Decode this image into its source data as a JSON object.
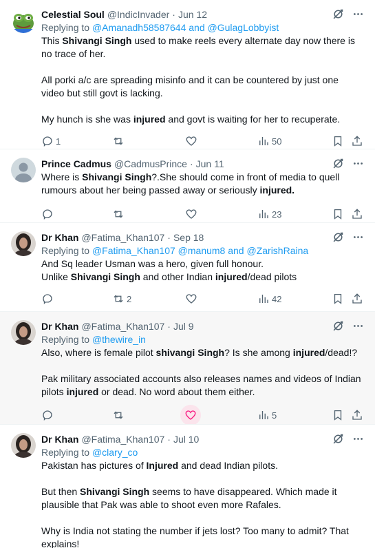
{
  "tweets": [
    {
      "name": "Celestial Soul",
      "handle": "@IndicInvader",
      "date": "Jun 12",
      "reply_prefix": "Replying to",
      "reply_targets": "@Amanadh58587644 and @GulagLobbyist",
      "paragraphs": [
        [
          {
            "t": "This "
          },
          {
            "t": "Shivangi Singh",
            "b": true
          },
          {
            "t": " used to make reels every alternate day now there is no trace of her."
          }
        ],
        [
          {
            "t": "All porki a/c are spreading misinfo and it can be countered by just one video but still govt is lacking."
          }
        ],
        [
          {
            "t": "My hunch is she was "
          },
          {
            "t": "injured",
            "b": true
          },
          {
            "t": " and govt is waiting for her to recuperate."
          }
        ]
      ],
      "replies": "1",
      "reposts": "",
      "likes": "",
      "views": "50"
    },
    {
      "name": "Prince Cadmus",
      "handle": "@CadmusPrince",
      "date": "Jun 11",
      "reply_prefix": "",
      "reply_targets": "",
      "paragraphs": [
        [
          {
            "t": "Where is "
          },
          {
            "t": "Shivangi Singh",
            "b": true
          },
          {
            "t": "?.She should come in front of media to quell rumours about her being passed away or seriously "
          },
          {
            "t": "injured.",
            "b": true
          }
        ]
      ],
      "replies": "",
      "reposts": "",
      "likes": "",
      "views": "23"
    },
    {
      "name": "Dr Khan",
      "handle": "@Fatima_Khan107",
      "date": "Sep 18",
      "reply_prefix": "Replying to",
      "reply_targets": "@Fatima_Khan107 @manum8 and @ZarishRaina",
      "paragraphs": [
        [
          {
            "t": "And Sq leader Usman was a hero, given full honour."
          },
          {
            "br": true
          },
          {
            "t": "Unlike "
          },
          {
            "t": "Shivangi Singh",
            "b": true
          },
          {
            "t": " and other Indian "
          },
          {
            "t": "injured",
            "b": true
          },
          {
            "t": "/dead pilots"
          }
        ]
      ],
      "replies": "",
      "reposts": "2",
      "likes": "",
      "views": "42"
    },
    {
      "name": "Dr Khan",
      "handle": "@Fatima_Khan107",
      "date": "Jul 9",
      "reply_prefix": "Replying to",
      "reply_targets": "@thewire_in",
      "paragraphs": [
        [
          {
            "t": "Also, where is female pilot "
          },
          {
            "t": "shivangi Singh",
            "b": true
          },
          {
            "t": "? Is she among "
          },
          {
            "t": "injured",
            "b": true
          },
          {
            "t": "/dead!?"
          }
        ],
        [
          {
            "t": "Pak military associated accounts also releases names and videos of Indian pilots "
          },
          {
            "t": "injured",
            "b": true
          },
          {
            "t": " or dead. No word about them either."
          }
        ]
      ],
      "replies": "",
      "reposts": "",
      "likes": "",
      "views": "5"
    },
    {
      "name": "Dr Khan",
      "handle": "@Fatima_Khan107",
      "date": "Jul 10",
      "reply_prefix": "Replying to",
      "reply_targets": "@clary_co",
      "paragraphs": [
        [
          {
            "t": "Pakistan has pictures of "
          },
          {
            "t": "Injured",
            "b": true
          },
          {
            "t": " and dead Indian pilots."
          }
        ],
        [
          {
            "t": "But then "
          },
          {
            "t": "Shivangi Singh",
            "b": true
          },
          {
            "t": " seems to have disappeared. Which made it plausible that Pak was able to shoot even more Rafales."
          }
        ],
        [
          {
            "t": "Why is India not stating the number if jets lost? Too many to admit? That explains!"
          }
        ]
      ],
      "replies": "",
      "reposts": "",
      "likes": "",
      "views": ""
    }
  ],
  "icons": {
    "reply": "comment-icon",
    "repost": "repost-icon",
    "like": "heart-icon",
    "views": "views-chart-icon",
    "bookmark": "bookmark-icon",
    "share": "share-icon",
    "grok": "grok-icon",
    "more": "more-dots-icon"
  },
  "colors": {
    "link": "#1d9bf0",
    "secondary_text": "#536471",
    "like_hover": "#f91880",
    "hover_row": "#f7f7f7"
  }
}
